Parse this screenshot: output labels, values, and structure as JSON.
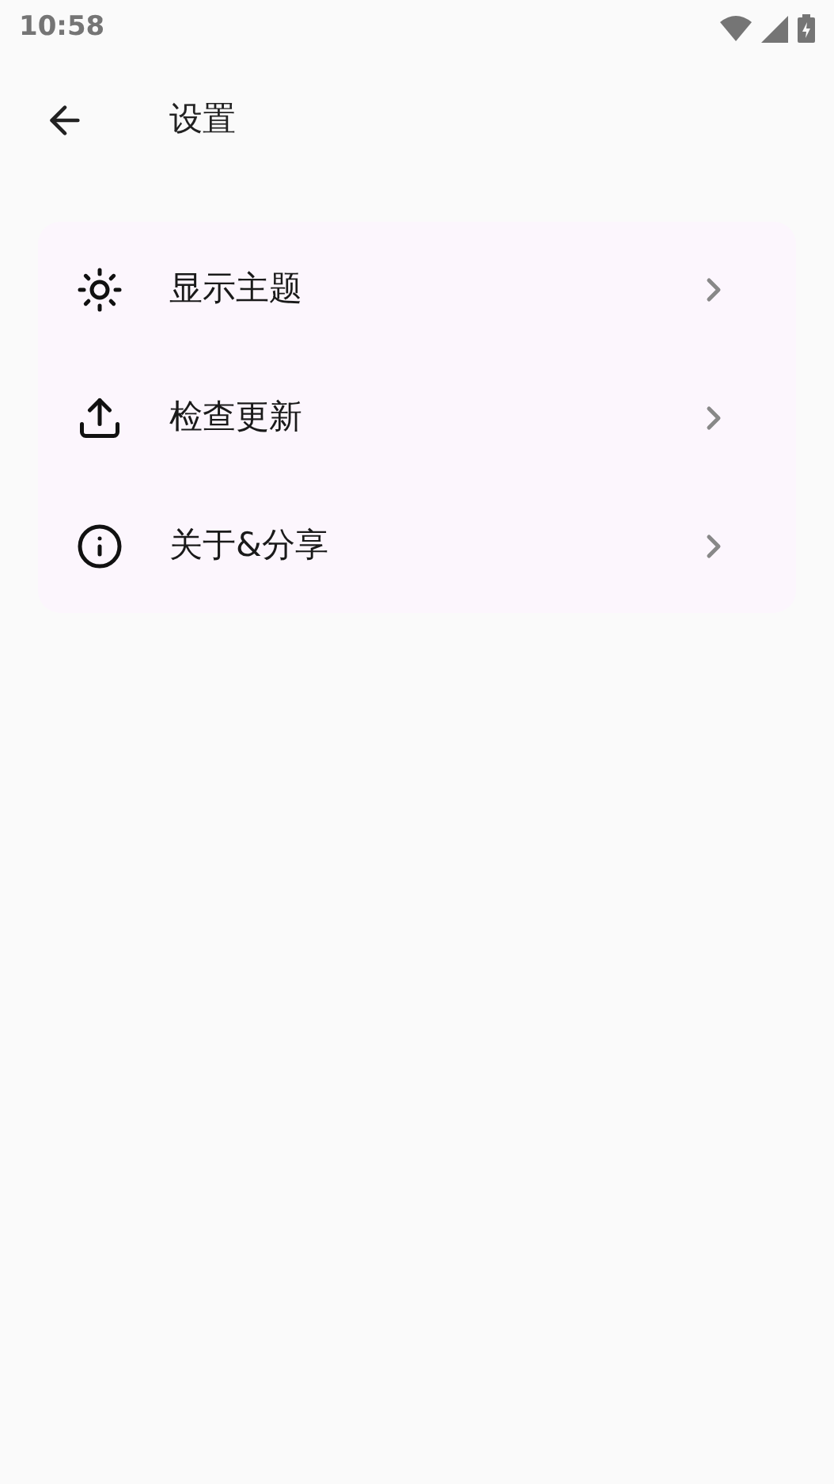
{
  "status_bar": {
    "time": "10:58"
  },
  "app_bar": {
    "title": "设置"
  },
  "settings": [
    {
      "kind": "theme",
      "label": "显示主题"
    },
    {
      "kind": "update",
      "label": "检查更新"
    },
    {
      "kind": "about",
      "label": "关于&分享"
    }
  ]
}
